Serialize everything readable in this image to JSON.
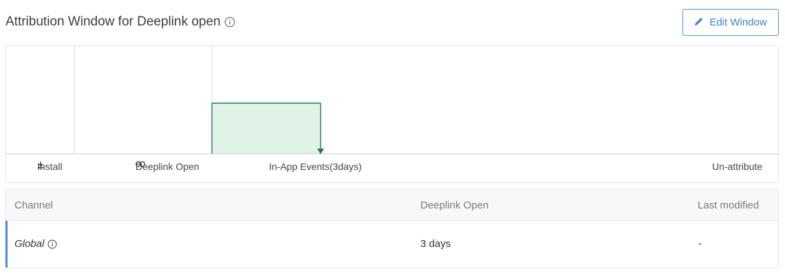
{
  "header": {
    "title": "Attribution Window for Deeplink open",
    "info_icon": "info-circle-icon",
    "edit_button_label": "Edit Window",
    "edit_button_icon": "pencil-icon"
  },
  "timeline": {
    "labels": {
      "install": "Install",
      "deeplink_open": "Deeplink Open",
      "in_app_events": "In-App Events(3days)",
      "unattribute": "Un-attribute"
    },
    "icons": {
      "install": "download-icon",
      "deeplink_open": "link-icon"
    },
    "window_days": 3,
    "window_color": "#dff3e7",
    "window_stroke": "#1f7a52"
  },
  "table": {
    "columns": [
      "Channel",
      "Deeplink Open",
      "Last modified"
    ],
    "rows": [
      {
        "channel": "Global",
        "deeplink_open": "3 days",
        "last_modified": "-"
      }
    ],
    "accent_color": "#4a90e2"
  }
}
